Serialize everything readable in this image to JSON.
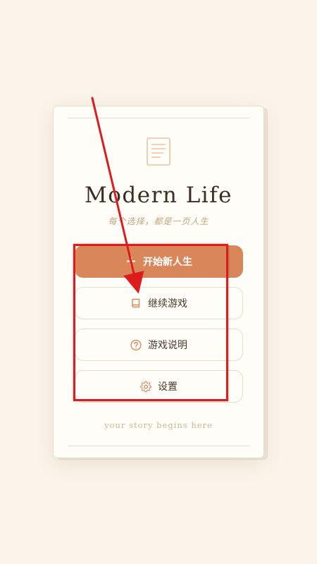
{
  "card": {
    "title": "Modern Life",
    "subtitle": "每个选择，都是一页人生",
    "tagline": "your story begins here"
  },
  "menu": {
    "start": {
      "label": "开始新人生",
      "icon": "plus-icon"
    },
    "continue": {
      "label": "继续游戏",
      "icon": "book-icon"
    },
    "help": {
      "label": "游戏说明",
      "icon": "question-circle-icon"
    },
    "settings": {
      "label": "设置",
      "icon": "gear-icon"
    }
  },
  "colors": {
    "background": "#fbf4ea",
    "card": "#fffdf8",
    "accent": "#d9875a",
    "title": "#3b2d24",
    "muted": "#c5a67f",
    "annotation": "#dd1d1d"
  }
}
